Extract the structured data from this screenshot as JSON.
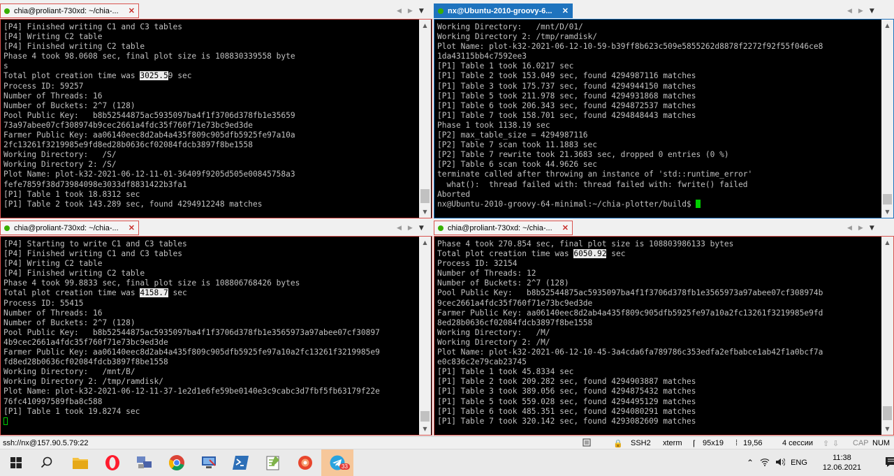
{
  "panes": [
    {
      "tab_title": "chia@proliant-730xd: ~/chia-...",
      "active": false,
      "lines": [
        {
          "t": "[P4] Finished writing C1 and C3 tables"
        },
        {
          "t": "[P4] Writing C2 table"
        },
        {
          "t": "[P4] Finished writing C2 table"
        },
        {
          "t": "Phase 4 took 98.0608 sec, final plot size is 108830339558 byte"
        },
        {
          "t": "s"
        },
        {
          "t": "Total plot creation time was ",
          "h": "3025.5",
          "a": "9 sec"
        },
        {
          "t": "Process ID: 59257"
        },
        {
          "t": "Number of Threads: 16"
        },
        {
          "t": "Number of Buckets: 2^7 (128)"
        },
        {
          "t": "Pool Public Key:   b8b52544875ac5935097ba4f1f3706d378fb1e35659"
        },
        {
          "t": "73a97abee07cf308974b9cec2661a4fdc35f760f71e73bc9ed3de"
        },
        {
          "t": "Farmer Public Key: aa06140eec8d2ab4a435f809c905dfb5925fe97a10a"
        },
        {
          "t": "2fc13261f3219985e9fd8ed28b0636cf02084fdcb3897f8be1558"
        },
        {
          "t": "Working Directory:   /S/"
        },
        {
          "t": "Working Directory 2: /S/"
        },
        {
          "t": "Plot Name: plot-k32-2021-06-12-11-01-36409f9205d505e00845758a3"
        },
        {
          "t": "fefe7859f38d73984098e3033df8831422b3fa1"
        },
        {
          "t": "[P1] Table 1 took 18.8312 sec"
        },
        {
          "t": "[P1] Table 2 took 143.289 sec, found 4294912248 matches"
        }
      ]
    },
    {
      "tab_title": "nx@Ubuntu-2010-groovy-6...",
      "active": true,
      "lines": [
        {
          "t": "Working Directory:   /mnt/D/01/"
        },
        {
          "t": "Working Directory 2: /tmp/ramdisk/"
        },
        {
          "t": "Plot Name: plot-k32-2021-06-12-10-59-b39ff8b623c509e5855262d8878f2272f92f55f046ce8"
        },
        {
          "t": "1da43115bb4c7592ee3"
        },
        {
          "t": "[P1] Table 1 took 16.0217 sec"
        },
        {
          "t": "[P1] Table 2 took 153.049 sec, found 4294987116 matches"
        },
        {
          "t": "[P1] Table 3 took 175.737 sec, found 4294944150 matches"
        },
        {
          "t": "[P1] Table 5 took 211.978 sec, found 4294931868 matches"
        },
        {
          "t": "[P1] Table 6 took 206.343 sec, found 4294872537 matches"
        },
        {
          "t": "[P1] Table 7 took 158.701 sec, found 4294848443 matches"
        },
        {
          "t": "Phase 1 took 1138.19 sec"
        },
        {
          "t": "[P2] max_table_size = 4294987116"
        },
        {
          "t": "[P2] Table 7 scan took 11.1883 sec"
        },
        {
          "t": "[P2] Table 7 rewrite took 21.3683 sec, dropped 0 entries (0 %)"
        },
        {
          "t": "[P2] Table 6 scan took 44.9626 sec"
        },
        {
          "t": "terminate called after throwing an instance of 'std::runtime_error'"
        },
        {
          "t": "  what():  thread failed with: thread failed with: fwrite() failed"
        },
        {
          "t": "Aborted"
        },
        {
          "t": "nx@Ubuntu-2010-groovy-64-minimal:~/chia-plotter/build$ ",
          "c": "solid"
        }
      ]
    },
    {
      "tab_title": "chia@proliant-730xd: ~/chia-...",
      "active": false,
      "lines": [
        {
          "t": "[P4] Starting to write C1 and C3 tables"
        },
        {
          "t": "[P4] Finished writing C1 and C3 tables"
        },
        {
          "t": "[P4] Writing C2 table"
        },
        {
          "t": "[P4] Finished writing C2 table"
        },
        {
          "t": "Phase 4 took 99.8833 sec, final plot size is 108806768426 bytes"
        },
        {
          "t": "Total plot creation time was ",
          "h": "4158.7",
          "a": " sec"
        },
        {
          "t": "Process ID: 55415"
        },
        {
          "t": "Number of Threads: 16"
        },
        {
          "t": "Number of Buckets: 2^7 (128)"
        },
        {
          "t": "Pool Public Key:   b8b52544875ac5935097ba4f1f3706d378fb1e3565973a97abee07cf30897"
        },
        {
          "t": "4b9cec2661a4fdc35f760f71e73bc9ed3de"
        },
        {
          "t": "Farmer Public Key: aa06140eec8d2ab4a435f809c905dfb5925fe97a10a2fc13261f3219985e9"
        },
        {
          "t": "fd8ed28b0636cf02084fdcb3897f8be1558"
        },
        {
          "t": "Working Directory:   /mnt/B/"
        },
        {
          "t": "Working Directory 2: /tmp/ramdisk/"
        },
        {
          "t": "Plot Name: plot-k32-2021-06-12-11-37-1e2d1e6fe59be0140e3c9cabc3d7fbf5fb63179f22e"
        },
        {
          "t": "76fc410997589fba8c588"
        },
        {
          "t": "[P1] Table 1 took 19.8274 sec"
        },
        {
          "t": "",
          "c": "hollow"
        }
      ]
    },
    {
      "tab_title": "chia@proliant-730xd: ~/chia-...",
      "active": false,
      "lines": [
        {
          "t": "Phase 4 took 270.854 sec, final plot size is 108803986133 bytes"
        },
        {
          "t": "Total plot creation time was ",
          "h": "6050.92",
          "a": " sec"
        },
        {
          "t": "Process ID: 32154"
        },
        {
          "t": "Number of Threads: 12"
        },
        {
          "t": "Number of Buckets: 2^7 (128)"
        },
        {
          "t": "Pool Public Key:   b8b52544875ac5935097ba4f1f3706d378fb1e3565973a97abee07cf308974b"
        },
        {
          "t": "9cec2661a4fdc35f760f71e73bc9ed3de"
        },
        {
          "t": "Farmer Public Key: aa06140eec8d2ab4a435f809c905dfb5925fe97a10a2fc13261f3219985e9fd"
        },
        {
          "t": "8ed28b0636cf02084fdcb3897f8be1558"
        },
        {
          "t": "Working Directory:   /M/"
        },
        {
          "t": "Working Directory 2: /M/"
        },
        {
          "t": "Plot Name: plot-k32-2021-06-12-10-45-3a4cda6fa789786c353edfa2efbabce1ab42f1a0bcf7a"
        },
        {
          "t": "e0c836c2e79cab23745"
        },
        {
          "t": "[P1] Table 1 took 45.8334 sec"
        },
        {
          "t": "[P1] Table 2 took 209.282 sec, found 4294903887 matches"
        },
        {
          "t": "[P1] Table 3 took 389.056 sec, found 4294875432 matches"
        },
        {
          "t": "[P1] Table 5 took 559.028 sec, found 4294495129 matches"
        },
        {
          "t": "[P1] Table 6 took 485.351 sec, found 4294080291 matches"
        },
        {
          "t": "[P1] Table 7 took 320.142 sec, found 4293082609 matches"
        }
      ]
    }
  ],
  "status_bar": {
    "connection": "ssh://nx@157.90.5.79:22",
    "protocol": "SSH2",
    "terminal_type": "xterm",
    "size": "95x19",
    "cursor_pos": "19,56",
    "sessions": "4 сессии",
    "caps": "CAP",
    "num": "NUM"
  },
  "taskbar": {
    "language": "ENG",
    "time": "11:38",
    "date": "12.06.2021",
    "badge": "33",
    "apps": [
      "windows-start",
      "search",
      "file-explorer",
      "opera",
      "network-manager",
      "chrome",
      "remote-desktop",
      "powershell",
      "notepad-plus",
      "browser-swirl",
      "telegram"
    ]
  },
  "colors": {
    "active_tab": "#1e73be",
    "inactive_tab_border": "#d9534f",
    "terminal_bg": "#000000",
    "terminal_fg": "#c0c0c0",
    "cursor": "#00d000"
  }
}
